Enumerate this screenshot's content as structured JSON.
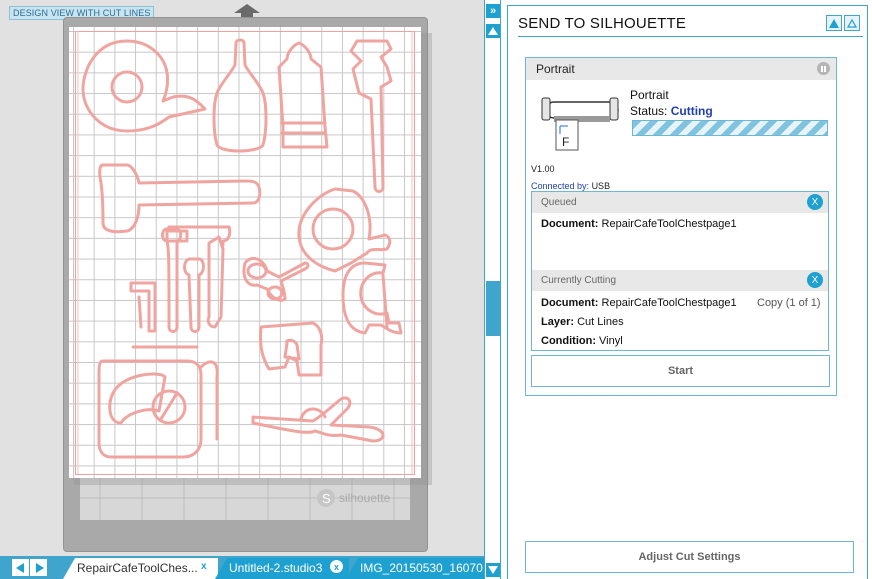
{
  "canvas": {
    "view_label": "DESIGN VIEW WITH CUT LINES",
    "watermark": "silhouette"
  },
  "tabs": {
    "items": [
      {
        "label": "RepairCafeToolChes...",
        "active": true
      },
      {
        "label": "Untitled-2.studio3",
        "active": false
      },
      {
        "label": "IMG_20150530_16070...",
        "active": false
      }
    ],
    "close_glyph": "x"
  },
  "scroll": {
    "collapse_glyph": "»"
  },
  "panel": {
    "title": "SEND TO SILHOUETTE",
    "device": {
      "header": "Portrait",
      "name": "Portrait",
      "status_label": "Status:",
      "status_value": "Cutting",
      "version": "V1.00",
      "connected_label": "Connected by:",
      "connected_value": "USB"
    },
    "queued": {
      "header": "Queued",
      "document_label": "Document:",
      "document_value": "RepairCafeToolChestpage1"
    },
    "current": {
      "header": "Currently Cutting",
      "document_label": "Document:",
      "document_value": "RepairCafeToolChestpage1",
      "copy": "Copy (1 of 1)",
      "layer_label": "Layer:",
      "layer_value": "Cut Lines",
      "condition_label": "Condition:",
      "condition_value": "Vinyl"
    },
    "x_glyph": "X",
    "start_label": "Start",
    "adjust_label": "Adjust Cut Settings"
  },
  "colors": {
    "accent": "#1ea1d1",
    "cut_line": "#f0a4a0",
    "status": "#1e3fae"
  }
}
